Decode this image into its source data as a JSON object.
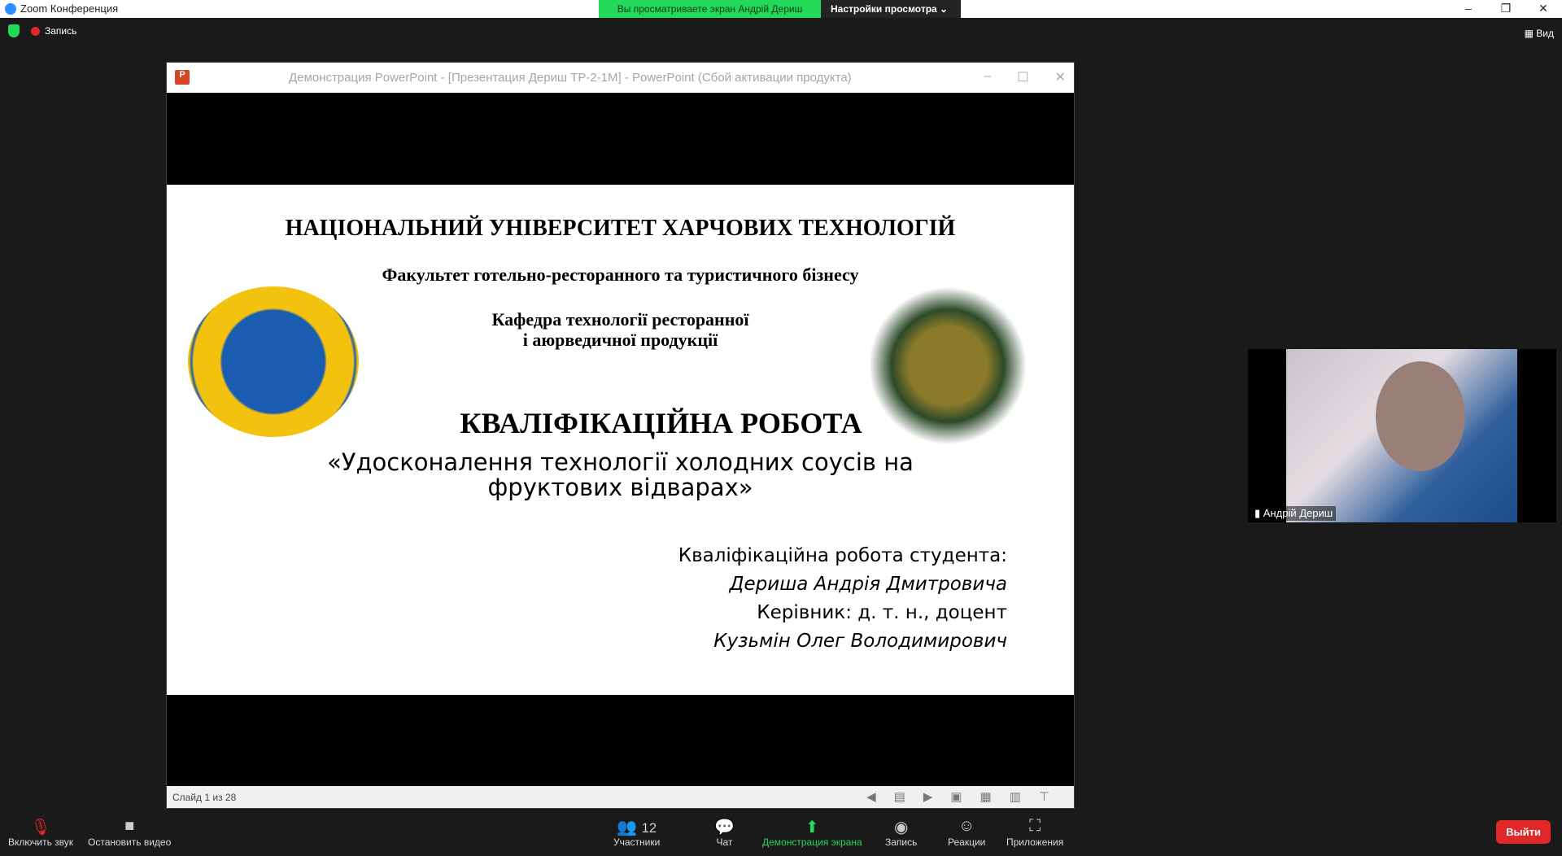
{
  "window": {
    "title": "Zoom Конференция",
    "minimize": "–",
    "restore": "❐",
    "close": "✕"
  },
  "banner": {
    "viewing": "Вы просматриваете экран Андрій Дериш",
    "view_options": "Настройки просмотра ⌄"
  },
  "topbar": {
    "recording": "Запись",
    "view": "Вид"
  },
  "ppt": {
    "title": "Демонстрация PowerPoint - [Презентация Дериш ТР-2-1М] - PowerPoint (Сбой активации продукта)",
    "icon": "P",
    "status": "Слайд 1 из 28"
  },
  "slide": {
    "university": "НАЦІОНАЛЬНИЙ УНІВЕРСИТЕТ ХАРЧОВИХ ТЕХНОЛОГІЙ",
    "faculty": "Факультет готельно-ресторанного та туристичного бізнесу",
    "department1": "Кафедра технології ресторанної",
    "department2": "і аюрведичної продукції",
    "work_type": "КВАЛІФІКАЦІЙНА РОБОТА",
    "topic1": "«Удосконалення технології холодних соусів на",
    "topic2": "фруктових відварах»",
    "student_label": "Кваліфікаційна робота студента:",
    "student": "Дериша Андрія Дмитровича",
    "supervisor_label": "Керівник: д. т. н., доцент",
    "supervisor": "Кузьмін Олег Володимирович"
  },
  "video": {
    "name": "Андрій Дериш"
  },
  "toolbar": {
    "mute": "Включить звук",
    "video": "Остановить видео",
    "participants": "Участники",
    "participants_count": "12",
    "chat": "Чат",
    "share": "Демонстрация экрана",
    "record": "Запись",
    "reactions": "Реакции",
    "apps": "Приложения",
    "leave": "Выйти"
  }
}
